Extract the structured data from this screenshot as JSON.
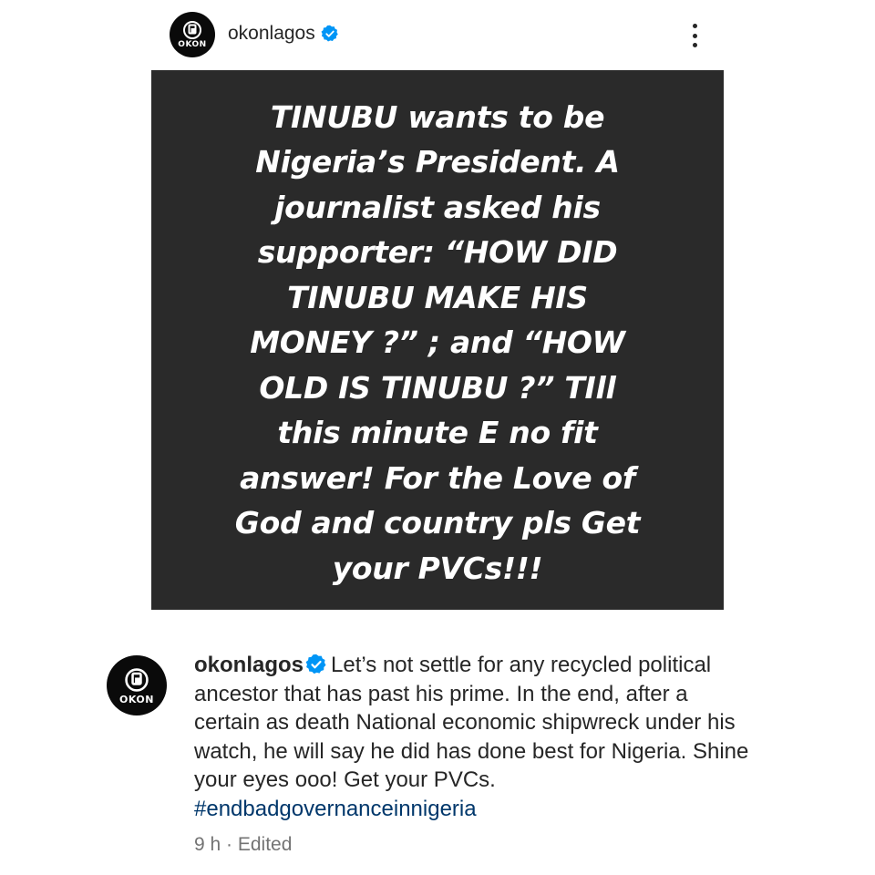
{
  "header": {
    "username": "okonlagos",
    "avatar_text": "OKON",
    "more_icon": "more-vertical-icon"
  },
  "post_image": {
    "text": "TINUBU wants to be Nigeria’s President. A journalist asked his supporter: “HOW DID TINUBU MAKE HIS MONEY ?” ; and “HOW OLD IS TINUBU ?” TIll this minute E no fit answer! For the Love of God and country pls Get your PVCs!!!",
    "background": "#2a2a2a",
    "text_color": "#ffffff"
  },
  "caption": {
    "username": "okonlagos",
    "avatar_text": "OKON",
    "body": "Let’s not settle for any recycled political ancestor that has past his prime. In the end, after a certain as death National economic shipwreck under his watch, he will say he did has done best for Nigeria. Shine your eyes ooo! Get your PVCs.",
    "hashtag": "#endbadgovernanceinnigeria"
  },
  "meta": {
    "time": "9 h",
    "separator": " · ",
    "edited": "Edited"
  },
  "colors": {
    "verified_badge": "#0095f6",
    "hashtag": "#00376b",
    "meta_text": "#737373"
  }
}
